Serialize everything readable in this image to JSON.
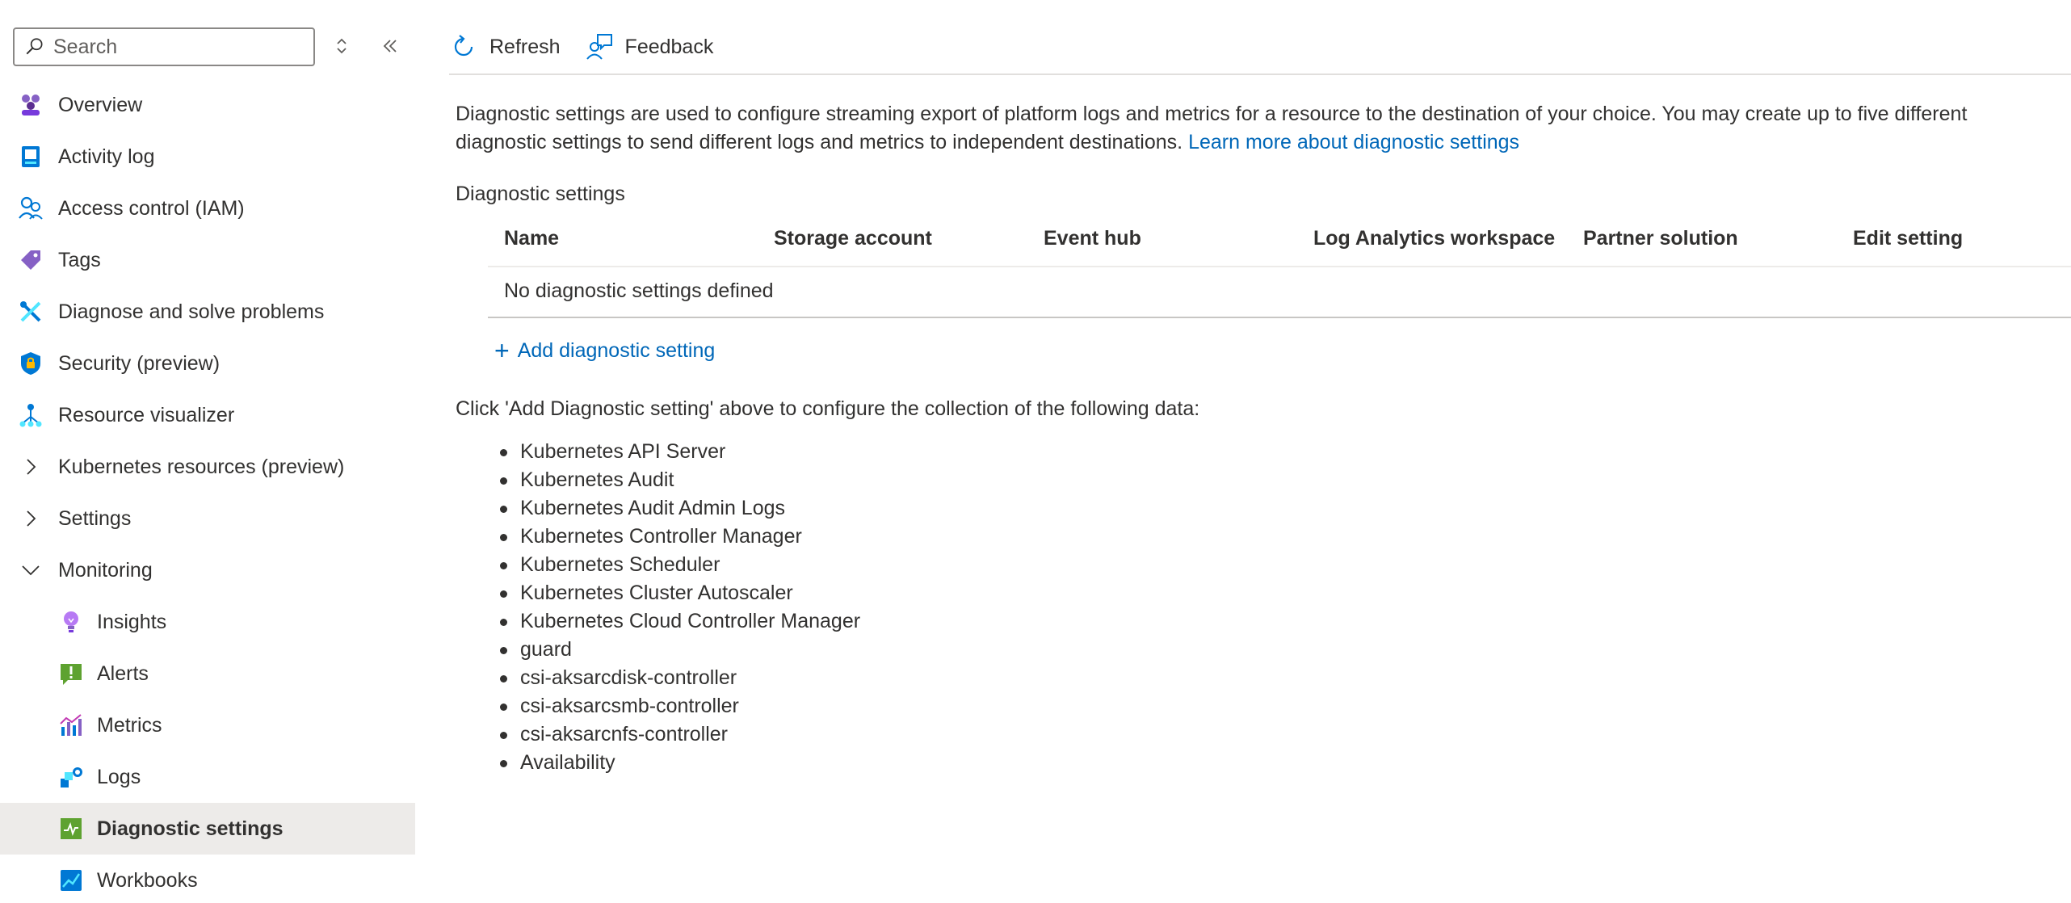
{
  "search": {
    "placeholder": "Search"
  },
  "sidebar": {
    "items": [
      {
        "label": "Overview",
        "icon": "overview-icon"
      },
      {
        "label": "Activity log",
        "icon": "activity-log-icon"
      },
      {
        "label": "Access control (IAM)",
        "icon": "iam-icon"
      },
      {
        "label": "Tags",
        "icon": "tag-icon"
      },
      {
        "label": "Diagnose and solve problems",
        "icon": "wrench-icon"
      },
      {
        "label": "Security (preview)",
        "icon": "shield-icon"
      },
      {
        "label": "Resource visualizer",
        "icon": "resource-visualizer-icon"
      },
      {
        "label": "Kubernetes resources (preview)",
        "icon": "chevron-right-icon"
      },
      {
        "label": "Settings",
        "icon": "chevron-right-icon"
      },
      {
        "label": "Monitoring",
        "icon": "chevron-down-icon"
      },
      {
        "label": "Insights",
        "icon": "lightbulb-icon"
      },
      {
        "label": "Alerts",
        "icon": "alert-icon"
      },
      {
        "label": "Metrics",
        "icon": "metrics-icon"
      },
      {
        "label": "Logs",
        "icon": "logs-icon"
      },
      {
        "label": "Diagnostic settings",
        "icon": "diagnostic-settings-icon",
        "selected": true
      },
      {
        "label": "Workbooks",
        "icon": "workbooks-icon"
      }
    ]
  },
  "toolbar": {
    "refresh_label": "Refresh",
    "feedback_label": "Feedback"
  },
  "main": {
    "description": "Diagnostic settings are used to configure streaming export of platform logs and metrics for a resource to the destination of your choice. You may create up to five different diagnostic settings to send different logs and metrics to independent destinations.",
    "learn_more_link": "Learn more about diagnostic settings",
    "section_title": "Diagnostic settings",
    "table": {
      "columns": [
        "Name",
        "Storage account",
        "Event hub",
        "Log Analytics workspace",
        "Partner solution",
        "Edit setting"
      ],
      "empty_message": "No diagnostic settings defined"
    },
    "add_label": "Add diagnostic setting",
    "instructions": "Click 'Add Diagnostic setting' above to configure the collection of the following data:",
    "data_items": [
      "Kubernetes API Server",
      "Kubernetes Audit",
      "Kubernetes Audit Admin Logs",
      "Kubernetes Controller Manager",
      "Kubernetes Scheduler",
      "Kubernetes Cluster Autoscaler",
      "Kubernetes Cloud Controller Manager",
      "guard",
      "csi-aksarcdisk-controller",
      "csi-aksarcsmb-controller",
      "csi-aksarcnfs-controller",
      "Availability"
    ]
  },
  "colors": {
    "link": "#0067b8",
    "selected_bg": "#edebe9",
    "text": "#323130"
  }
}
